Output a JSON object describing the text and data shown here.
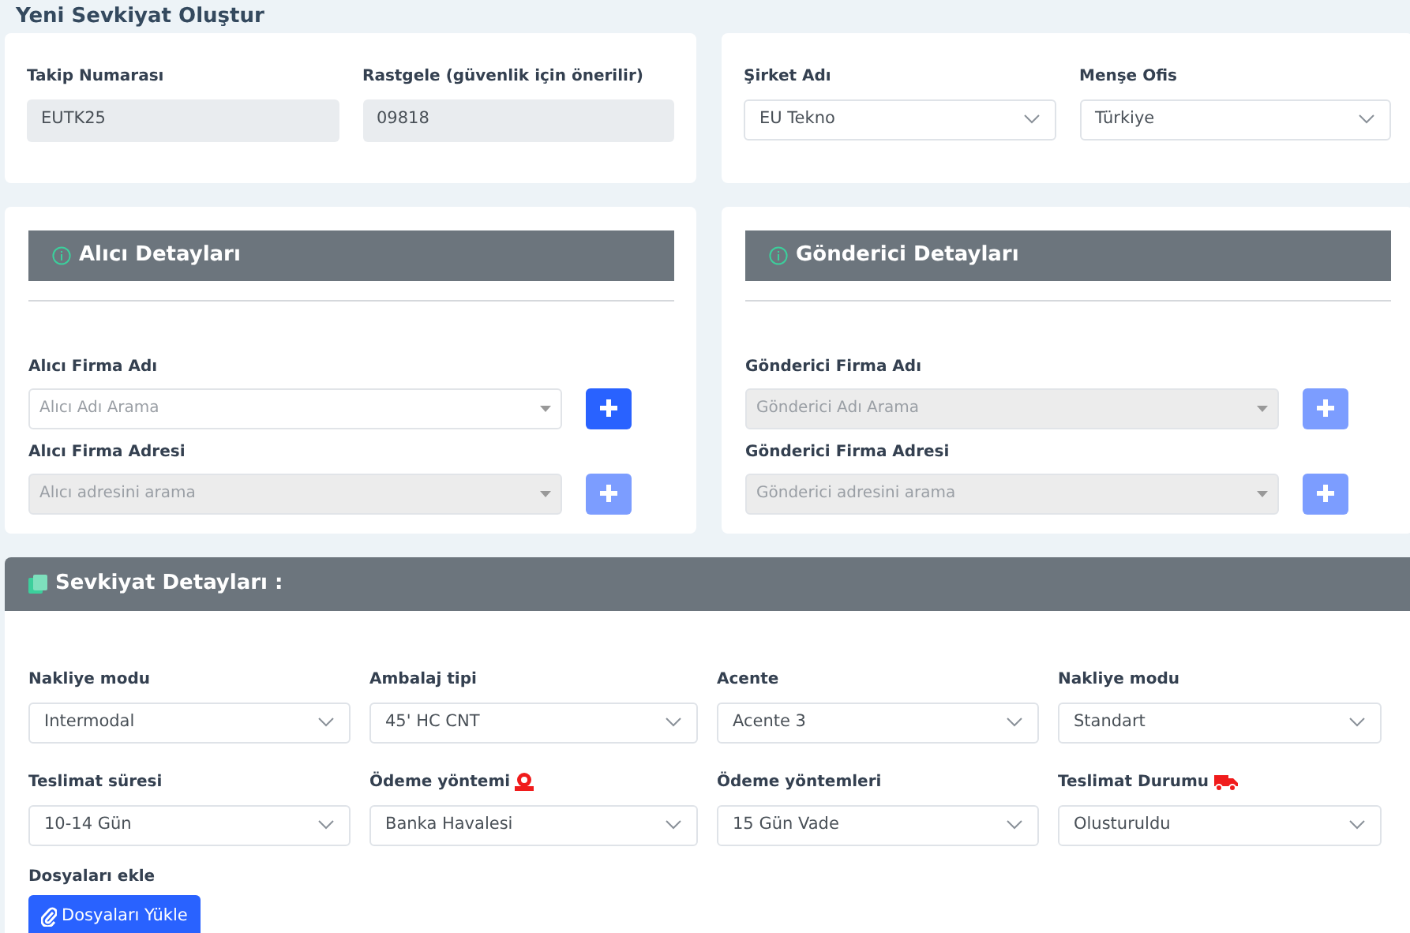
{
  "page_title": "Yeni Sevkiyat Oluştur",
  "tracking": [
    {
      "label": "Takip Numarası",
      "value": "EUTK25"
    },
    {
      "label": "Rastgele (güvenlik için önerilir)",
      "value": "09818"
    }
  ],
  "company": [
    {
      "label": "Şirket Adı",
      "value": "EU Tekno"
    },
    {
      "label": "Menşe Ofis",
      "value": "Türkiye"
    }
  ],
  "parties": [
    {
      "title": "Alıcı Detayları",
      "fields": [
        {
          "label": "Alıcı Firma Adı",
          "placeholder": "Alıcı Adı Arama",
          "disabled": false
        },
        {
          "label": "Alıcı Firma Adresi",
          "placeholder": "Alıcı adresini arama",
          "disabled": true
        }
      ]
    },
    {
      "title": "Gönderici Detayları",
      "fields": [
        {
          "label": "Gönderici Firma Adı",
          "placeholder": "Gönderici Adı Arama",
          "disabled": true
        },
        {
          "label": "Gönderici Firma Adresi",
          "placeholder": "Gönderici adresini arama",
          "disabled": true
        }
      ]
    }
  ],
  "shipment": {
    "title": "Sevkiyat Detayları :",
    "fields": [
      {
        "label": "Nakliye modu",
        "value": "Intermodal",
        "kind": "plain"
      },
      {
        "label": "Ambalaj tipi",
        "value": "45' HC CNT",
        "kind": "plain"
      },
      {
        "label": "Acente",
        "value": "Acente 3",
        "kind": "plain"
      },
      {
        "label": "Nakliye modu",
        "value": "Standart",
        "kind": "plain"
      },
      {
        "label": "Teslimat süresi",
        "value": "10-14 Gün",
        "kind": "plain"
      },
      {
        "label": "Ödeme yöntemi",
        "value": "Banka Havalesi",
        "kind": "money"
      },
      {
        "label": "Ödeme yöntemleri",
        "value": "15 Gün Vade",
        "kind": "plain"
      },
      {
        "label": "Teslimat Durumu",
        "value": "Olusturuldu",
        "kind": "truck"
      }
    ],
    "upload_label": "Dosyaları ekle",
    "upload_button": "Dosyaları Yükle"
  }
}
